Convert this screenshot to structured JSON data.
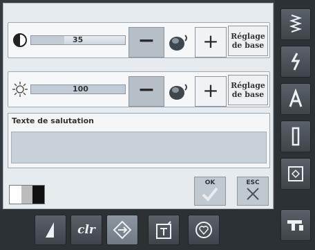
{
  "contrast_row": {
    "value_text": "35",
    "level": 0.35,
    "reset_label_1": "Réglage",
    "reset_label_2": "de base",
    "minus": "−",
    "plus": "+"
  },
  "brightness_row": {
    "value_text": "100",
    "level": 1.0,
    "reset_label_1": "Réglage",
    "reset_label_2": "de base",
    "minus": "−",
    "plus": "+"
  },
  "greeting": {
    "title": "Texte de salutation",
    "value": ""
  },
  "ok_label": "OK",
  "esc_label": "ESC",
  "clr_label": "clr",
  "colors": {
    "panel": "#e6ebef",
    "dark": "#2c3136",
    "button": "#b6bec6"
  },
  "sidebar_icons": [
    "stitch-zigzag-icon",
    "lightning-stitch-icon",
    "alphabet-icon",
    "buttonhole-icon",
    "embroidery-hoop-icon",
    "sewing-machine-icon"
  ],
  "bottom_icons": [
    "needle-icon",
    "clr-icon",
    "navigate-icon",
    "tools-icon",
    "favorite-icon"
  ]
}
